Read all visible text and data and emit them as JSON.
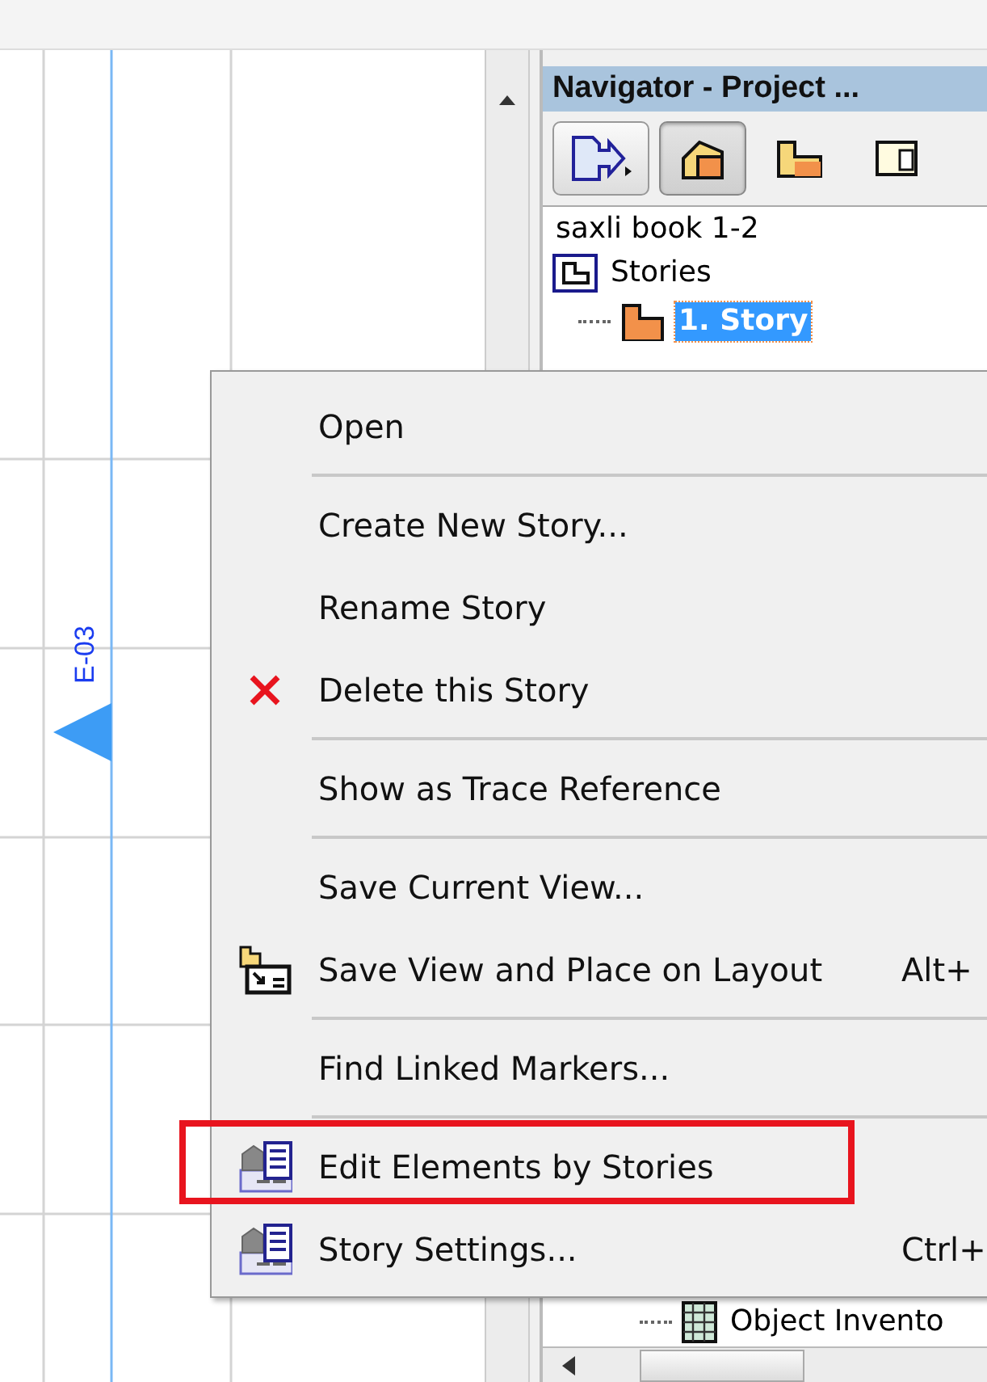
{
  "canvas": {
    "marker_label": "E-03"
  },
  "navigator": {
    "title": "Navigator - Project ...",
    "toolbar": [
      {
        "kind": "publish",
        "selected": false
      },
      {
        "kind": "project",
        "selected": true
      },
      {
        "kind": "views",
        "selected": false
      },
      {
        "kind": "layouts",
        "selected": false
      }
    ],
    "tree": [
      {
        "label": "saxli book 1-2",
        "selected": false,
        "children": [
          {
            "label": "Stories",
            "kind": "stories",
            "selected": false,
            "children": [
              {
                "label": "1. Story",
                "kind": "story",
                "selected": true
              }
            ]
          }
        ]
      }
    ],
    "tree_bottom": [
      {
        "label": "Object Invento",
        "kind": "list",
        "selected": false
      }
    ]
  },
  "menu": {
    "items": [
      {
        "kind": "item",
        "label": "Open"
      },
      {
        "kind": "separator"
      },
      {
        "kind": "item",
        "label": "Create New Story..."
      },
      {
        "kind": "item",
        "label": "Rename Story"
      },
      {
        "kind": "delete",
        "label": "Delete this Story"
      },
      {
        "kind": "separator"
      },
      {
        "kind": "item",
        "label": "Show as Trace Reference"
      },
      {
        "kind": "separator"
      },
      {
        "kind": "item",
        "label": "Save Current View..."
      },
      {
        "kind": "layout",
        "label": "Save View and Place on Layout",
        "shortcut": "Alt+"
      },
      {
        "kind": "separator"
      },
      {
        "kind": "item",
        "label": "Find Linked Markers..."
      },
      {
        "kind": "separator"
      },
      {
        "kind": "stories",
        "label": "Edit Elements by Stories",
        "highlighted": true
      },
      {
        "kind": "stories",
        "label": "Story Settings...",
        "shortcut": "Ctrl+"
      }
    ]
  }
}
